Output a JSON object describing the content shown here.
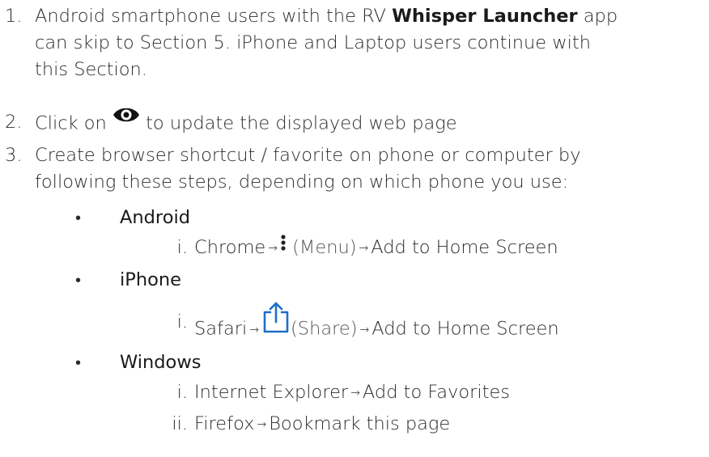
{
  "items": [
    {
      "number": "1.",
      "text_a": "Android smartphone users with the RV ",
      "text_strong": "Whisper Launcher",
      "text_b": " app",
      "line2": "can skip to Section 5.  iPhone and Laptop users continue with",
      "line3": "this Section."
    },
    {
      "number": "2.",
      "text_a": "Click on ",
      "icon": "eye-icon",
      "text_b": " to update the displayed web page"
    },
    {
      "number": "3.",
      "line1": "Create browser shortcut / favorite on phone or computer by",
      "line2": "following these steps, depending on which phone you use:"
    }
  ],
  "bullets": [
    {
      "label": "Android",
      "steps": [
        {
          "roman": "i.",
          "a": "Chrome",
          "arrow1": "→",
          "icon": "kebab-menu-icon",
          "paren": "(Menu)",
          "arrow2": "→",
          "b": "Add to Home Screen"
        }
      ]
    },
    {
      "label": "iPhone",
      "steps": [
        {
          "roman": "i.",
          "a": "Safari",
          "arrow1": "→",
          "icon": "share-icon",
          "paren": "(Share)",
          "arrow2": "→",
          "b": "Add to Home Screen"
        }
      ]
    },
    {
      "label": "Windows",
      "steps": [
        {
          "roman": "i.",
          "a": "Internet Explorer",
          "arrow1": "→",
          "b": "Add to Favorites"
        },
        {
          "roman": "ii.",
          "a": "Firefox",
          "arrow1": "→",
          "b": "Bookmark this page"
        }
      ]
    }
  ],
  "bullet_glyph": "•"
}
